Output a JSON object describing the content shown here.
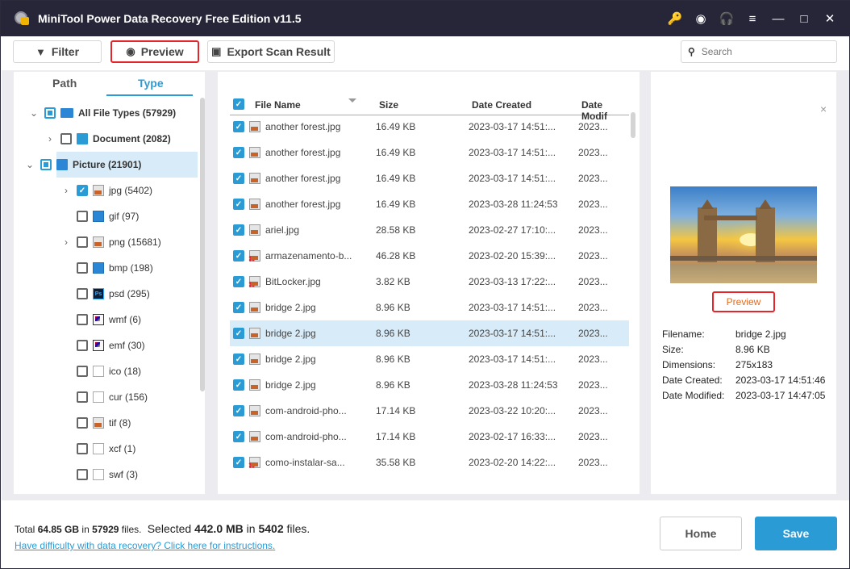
{
  "window": {
    "title": "MiniTool Power Data Recovery Free Edition v11.5",
    "controls": [
      {
        "name": "key-icon",
        "glyph": "🔑",
        "color": "#f0b400"
      },
      {
        "name": "disc-icon",
        "glyph": "◉",
        "color": "#ffffff"
      },
      {
        "name": "headphones-icon",
        "glyph": "🎧",
        "color": "#ffffff"
      },
      {
        "name": "menu-icon",
        "glyph": "≡",
        "color": "#ffffff"
      },
      {
        "name": "minimize-icon",
        "glyph": "—",
        "color": "#ffffff"
      },
      {
        "name": "maximize-icon",
        "glyph": "□",
        "color": "#ffffff"
      },
      {
        "name": "close-icon",
        "glyph": "✕",
        "color": "#ffffff"
      }
    ]
  },
  "toolbar": {
    "filter_label": "Filter",
    "filter_icon": "▼",
    "preview_label": "Preview",
    "preview_icon": "◉",
    "export_label": "Export Scan Result",
    "export_icon": "▣",
    "search_placeholder": "Search",
    "search_icon": "🔍"
  },
  "left": {
    "tabs": [
      {
        "label": "Path"
      },
      {
        "label": "Type"
      }
    ],
    "active_tab": "Type",
    "tree": [
      {
        "label": "All File Types (57929)",
        "level": 0,
        "chevron": "⌄",
        "check": "partial",
        "icon": "monitor",
        "bold": true
      },
      {
        "label": "Document (2082)",
        "level": 1,
        "chevron": "›",
        "check": "none",
        "icon": "docblue",
        "bold": true
      },
      {
        "label": "Picture (21901)",
        "level": 1,
        "chevron": "⌄",
        "check": "partial",
        "icon": "picblue",
        "bold": true,
        "selected": true
      },
      {
        "label": "jpg (5402)",
        "level": 2,
        "chevron": "›",
        "check": "checked",
        "icon": "pic"
      },
      {
        "label": "gif (97)",
        "level": 2,
        "chevron": "",
        "check": "none",
        "icon": "blue"
      },
      {
        "label": "png (15681)",
        "level": 2,
        "chevron": "›",
        "check": "none",
        "icon": "pic"
      },
      {
        "label": "bmp (198)",
        "level": 2,
        "chevron": "",
        "check": "none",
        "icon": "blue"
      },
      {
        "label": "psd (295)",
        "level": 2,
        "chevron": "",
        "check": "none",
        "icon": "ps"
      },
      {
        "label": "wmf (6)",
        "level": 2,
        "chevron": "",
        "check": "none",
        "icon": "meta"
      },
      {
        "label": "emf (30)",
        "level": 2,
        "chevron": "",
        "check": "none",
        "icon": "meta"
      },
      {
        "label": "ico (18)",
        "level": 2,
        "chevron": "",
        "check": "none",
        "icon": "doc"
      },
      {
        "label": "cur (156)",
        "level": 2,
        "chevron": "",
        "check": "none",
        "icon": "doc"
      },
      {
        "label": "tif (8)",
        "level": 2,
        "chevron": "",
        "check": "none",
        "icon": "pic"
      },
      {
        "label": "xcf (1)",
        "level": 2,
        "chevron": "",
        "check": "none",
        "icon": "doc"
      },
      {
        "label": "swf (3)",
        "level": 2,
        "chevron": "",
        "check": "none",
        "icon": "doc"
      }
    ]
  },
  "table": {
    "columns": [
      "File Name",
      "Size",
      "Date Created",
      "Date Modif"
    ],
    "header_checked": true,
    "rows": [
      {
        "name": "another forest.jpg",
        "size": "16.49 KB",
        "created": "2023-03-17 14:51:...",
        "modified": "2023...",
        "deleted": false
      },
      {
        "name": "another forest.jpg",
        "size": "16.49 KB",
        "created": "2023-03-17 14:51:...",
        "modified": "2023...",
        "deleted": false
      },
      {
        "name": "another forest.jpg",
        "size": "16.49 KB",
        "created": "2023-03-17 14:51:...",
        "modified": "2023...",
        "deleted": false
      },
      {
        "name": "another forest.jpg",
        "size": "16.49 KB",
        "created": "2023-03-28 11:24:53",
        "modified": "2023...",
        "deleted": false
      },
      {
        "name": "ariel.jpg",
        "size": "28.58 KB",
        "created": "2023-02-27 17:10:...",
        "modified": "2023...",
        "deleted": false
      },
      {
        "name": "armazenamento-b...",
        "size": "46.28 KB",
        "created": "2023-02-20 15:39:...",
        "modified": "2023...",
        "deleted": true
      },
      {
        "name": "BitLocker.jpg",
        "size": "3.82 KB",
        "created": "2023-03-13 17:22:...",
        "modified": "2023...",
        "deleted": true
      },
      {
        "name": "bridge 2.jpg",
        "size": "8.96 KB",
        "created": "2023-03-17 14:51:...",
        "modified": "2023...",
        "deleted": false
      },
      {
        "name": "bridge 2.jpg",
        "size": "8.96 KB",
        "created": "2023-03-17 14:51:...",
        "modified": "2023...",
        "deleted": false,
        "selected": true
      },
      {
        "name": "bridge 2.jpg",
        "size": "8.96 KB",
        "created": "2023-03-17 14:51:...",
        "modified": "2023...",
        "deleted": false
      },
      {
        "name": "bridge 2.jpg",
        "size": "8.96 KB",
        "created": "2023-03-28 11:24:53",
        "modified": "2023...",
        "deleted": false
      },
      {
        "name": "com-android-pho...",
        "size": "17.14 KB",
        "created": "2023-03-22 10:20:...",
        "modified": "2023...",
        "deleted": false
      },
      {
        "name": "com-android-pho...",
        "size": "17.14 KB",
        "created": "2023-02-17 16:33:...",
        "modified": "2023...",
        "deleted": false
      },
      {
        "name": "como-instalar-sa...",
        "size": "35.58 KB",
        "created": "2023-02-20 14:22:...",
        "modified": "2023...",
        "deleted": true
      }
    ]
  },
  "preview_panel": {
    "close_glyph": "×",
    "preview_label": "Preview",
    "info": [
      {
        "key": "Filename:",
        "value": "bridge 2.jpg"
      },
      {
        "key": "Size:",
        "value": "8.96 KB"
      },
      {
        "key": "Dimensions:",
        "value": "275x183"
      },
      {
        "key": "Date Created:",
        "value": "2023-03-17 14:51:46"
      },
      {
        "key": "Date Modified:",
        "value": "2023-03-17 14:47:05"
      }
    ]
  },
  "footer": {
    "total_prefix": "Total ",
    "total_size": "64.85 GB",
    "total_mid": " in ",
    "total_files": "57929",
    "total_suffix": " files.",
    "selected_prefix": "Selected ",
    "selected_size": "442.0 MB",
    "selected_mid": " in ",
    "selected_files": "5402",
    "selected_suffix": " files.",
    "help_link": "Have difficulty with data recovery? Click here for instructions.",
    "home_label": "Home",
    "save_label": "Save"
  },
  "colors": {
    "accent": "#2b9bd6",
    "highlight": "#e3262c",
    "titlebar": "#262638",
    "selected_row": "#d8ebf8"
  }
}
